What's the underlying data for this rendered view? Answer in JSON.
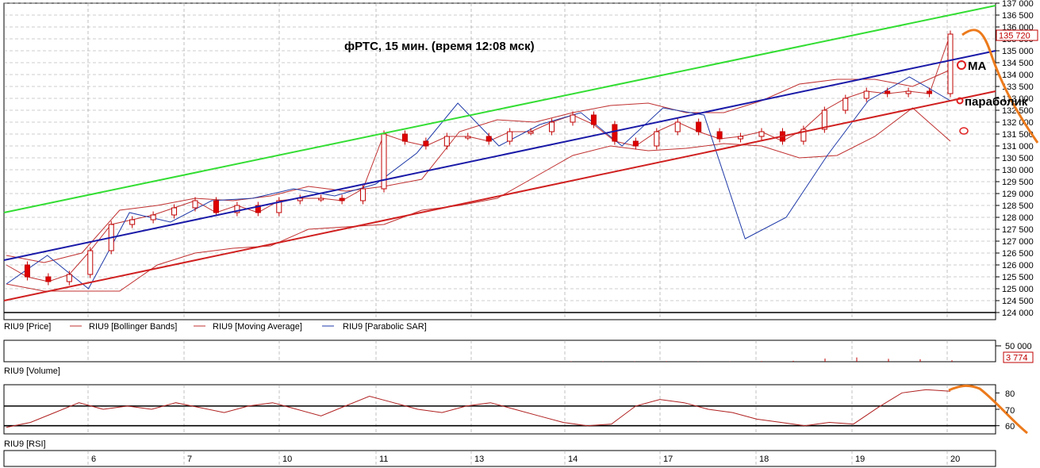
{
  "colors": {
    "candle_up": "#ffffff",
    "candle_down": "#e00000",
    "candle_edge": "#c00000",
    "bollinger": "#c03030",
    "moving_average": "#c03030",
    "parabolic_sar": "#1f3aa8",
    "trend_green": "#33dd33",
    "trend_blue": "#1a1aa8",
    "trend_red": "#d02020",
    "annotation_orange": "#ec7a1c",
    "grid": "#9a9a9a",
    "volume": "#c00000",
    "rsi": "#b02020"
  },
  "chart_data": [
    {
      "type": "candlestick",
      "title": "фРТС,  15 мин. (время 12:08 мск)",
      "ylim": [
        123700,
        137000
      ],
      "y_ticks": [
        124000,
        124500,
        125000,
        125500,
        126000,
        126500,
        127000,
        127500,
        128000,
        128500,
        129000,
        129500,
        130000,
        130500,
        131000,
        131500,
        132000,
        132500,
        133000,
        133500,
        134000,
        134500,
        135000,
        135500,
        136000,
        136500,
        137000
      ],
      "y_tick_labels": [
        "124 000",
        "124 500",
        "125 000",
        "125 500",
        "126 000",
        "126 500",
        "127 000",
        "127 500",
        "128 000",
        "128 500",
        "129 000",
        "129 500",
        "130 000",
        "130 500",
        "131 000",
        "131 500",
        "132 000",
        "132 500",
        "133 000",
        "133 500",
        "134 000",
        "134 500",
        "135 000",
        "135 500",
        "136 000",
        "136 500",
        "137 000"
      ],
      "last_price_label": "135 720",
      "legend": [
        "RIU9 [Price]",
        "RIU9 [Bollinger Bands]",
        "RIU9 [Moving Average]",
        "RIU9 [Parabolic SAR]"
      ],
      "annotations": [
        "MA",
        "параболик"
      ],
      "x_day_labels": [
        "6",
        "7",
        "10",
        "11",
        "13",
        "14",
        "17",
        "18",
        "19",
        "20"
      ],
      "trend_lines": [
        {
          "color": "green",
          "y_start": 128200,
          "y_end": 136900
        },
        {
          "color": "blue",
          "y_start": 126200,
          "y_end": 135000
        },
        {
          "color": "red",
          "y_start": 124500,
          "y_end": 133300
        }
      ],
      "support_level": 124000,
      "close_series_approx": [
        126000,
        125500,
        125300,
        125600,
        126600,
        127700,
        127900,
        128100,
        128400,
        128700,
        128200,
        128500,
        128200,
        128700,
        128800,
        128800,
        128700,
        129200,
        131500,
        131200,
        131000,
        131400,
        131400,
        131200,
        131600,
        131600,
        132000,
        132300,
        131900,
        131200,
        131000,
        131600,
        132000,
        131600,
        131300,
        131400,
        131600,
        131200,
        131700,
        132500,
        133000,
        133300,
        133200,
        133300,
        133200,
        135700
      ],
      "bollinger_upper_approx": [
        126400,
        126100,
        126500,
        128300,
        128500,
        128800,
        128700,
        128900,
        129300,
        129100,
        129300,
        129600,
        131600,
        132100,
        132000,
        132400,
        132700,
        132800,
        132400,
        132400,
        132900,
        133600,
        133800,
        133800,
        133500,
        134200
      ],
      "bollinger_lower_approx": [
        125200,
        124900,
        124900,
        124900,
        126000,
        126500,
        126700,
        126800,
        127500,
        127600,
        127700,
        128300,
        128500,
        128800,
        129700,
        130600,
        131000,
        130800,
        130900,
        131100,
        131000,
        130500,
        130600,
        131400,
        132600,
        131200
      ],
      "parabolic_sar_approx": [
        125200,
        126400,
        125000,
        128200,
        127800,
        128700,
        128800,
        129200,
        128900,
        129400,
        130700,
        132800,
        131000,
        131900,
        132400,
        131000,
        132600,
        132300,
        127100,
        128000,
        130600,
        132900,
        133900,
        132900
      ]
    },
    {
      "type": "bar",
      "title": "RIU9 [Volume]",
      "ylim": [
        0,
        60000
      ],
      "y_tick_labels": [
        "50 000"
      ],
      "last_value_label": "3 774",
      "values_approx_recent": [
        1200,
        800,
        900,
        1500,
        700,
        600,
        1800,
        2400,
        9000,
        12000,
        8000,
        7000,
        3774
      ]
    },
    {
      "type": "line",
      "title": "RIU9 [RSI]",
      "ylim": [
        55,
        85
      ],
      "y_ticks": [
        60,
        70,
        80
      ],
      "y_tick_labels": [
        "60",
        "70",
        "80"
      ],
      "reference_levels": [
        60,
        72
      ],
      "values_approx": [
        59,
        62,
        68,
        74,
        70,
        72,
        70,
        74,
        71,
        68,
        72,
        74,
        70,
        66,
        72,
        78,
        74,
        70,
        68,
        72,
        74,
        70,
        66,
        62,
        60,
        61,
        72,
        76,
        74,
        70,
        68,
        64,
        62,
        60,
        62,
        61,
        71,
        80,
        82,
        81
      ]
    }
  ]
}
